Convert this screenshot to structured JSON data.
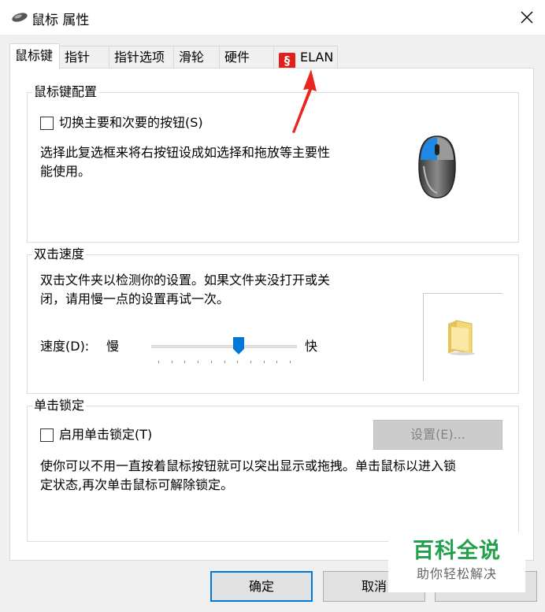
{
  "window": {
    "title": "鼠标 属性",
    "title_icon": "mouse-icon",
    "close_icon": "close-icon"
  },
  "tabs": [
    {
      "label": "鼠标键",
      "active": true
    },
    {
      "label": "指针",
      "active": false
    },
    {
      "label": "指针选项",
      "active": false
    },
    {
      "label": "滑轮",
      "active": false
    },
    {
      "label": "硬件",
      "active": false
    },
    {
      "label": "ELAN",
      "active": false,
      "icon": "elan-logo-icon"
    }
  ],
  "button_config": {
    "title": "鼠标键配置",
    "switch_checkbox_label": "切换主要和次要的按钮(S)",
    "switch_checked": false,
    "description_line1": "选择此复选框来将右按钮设成如选择和拖放等主要性",
    "description_line2": "能使用。",
    "image_icon": "mouse-illustration-icon"
  },
  "double_click": {
    "title": "双击速度",
    "description_line1": "双击文件夹以检测你的设置。如果文件夹没打开或关",
    "description_line2": "闭，请用慢一点的设置再试一次。",
    "speed_label": "速度(D):",
    "slow_label": "慢",
    "fast_label": "快",
    "slider_value": 0.6,
    "test_icon": "folder-icon"
  },
  "click_lock": {
    "title": "单击锁定",
    "checkbox_label": "启用单击锁定(T)",
    "checked": false,
    "settings_button": "设置(E)...",
    "description_line1": "使你可以不用一直按着鼠标按钮就可以突出显示或拖拽。单击鼠标以进入锁",
    "description_line2": "定状态,再次单击鼠标可解除锁定。"
  },
  "footer": {
    "ok_label": "确定",
    "cancel_label": "取消"
  },
  "watermark": {
    "title": "百科全说",
    "subtitle": "助你轻松解决"
  },
  "colors": {
    "accent": "#0078d7",
    "annotation_arrow": "#e8251e",
    "watermark_green": "#22a04b"
  }
}
